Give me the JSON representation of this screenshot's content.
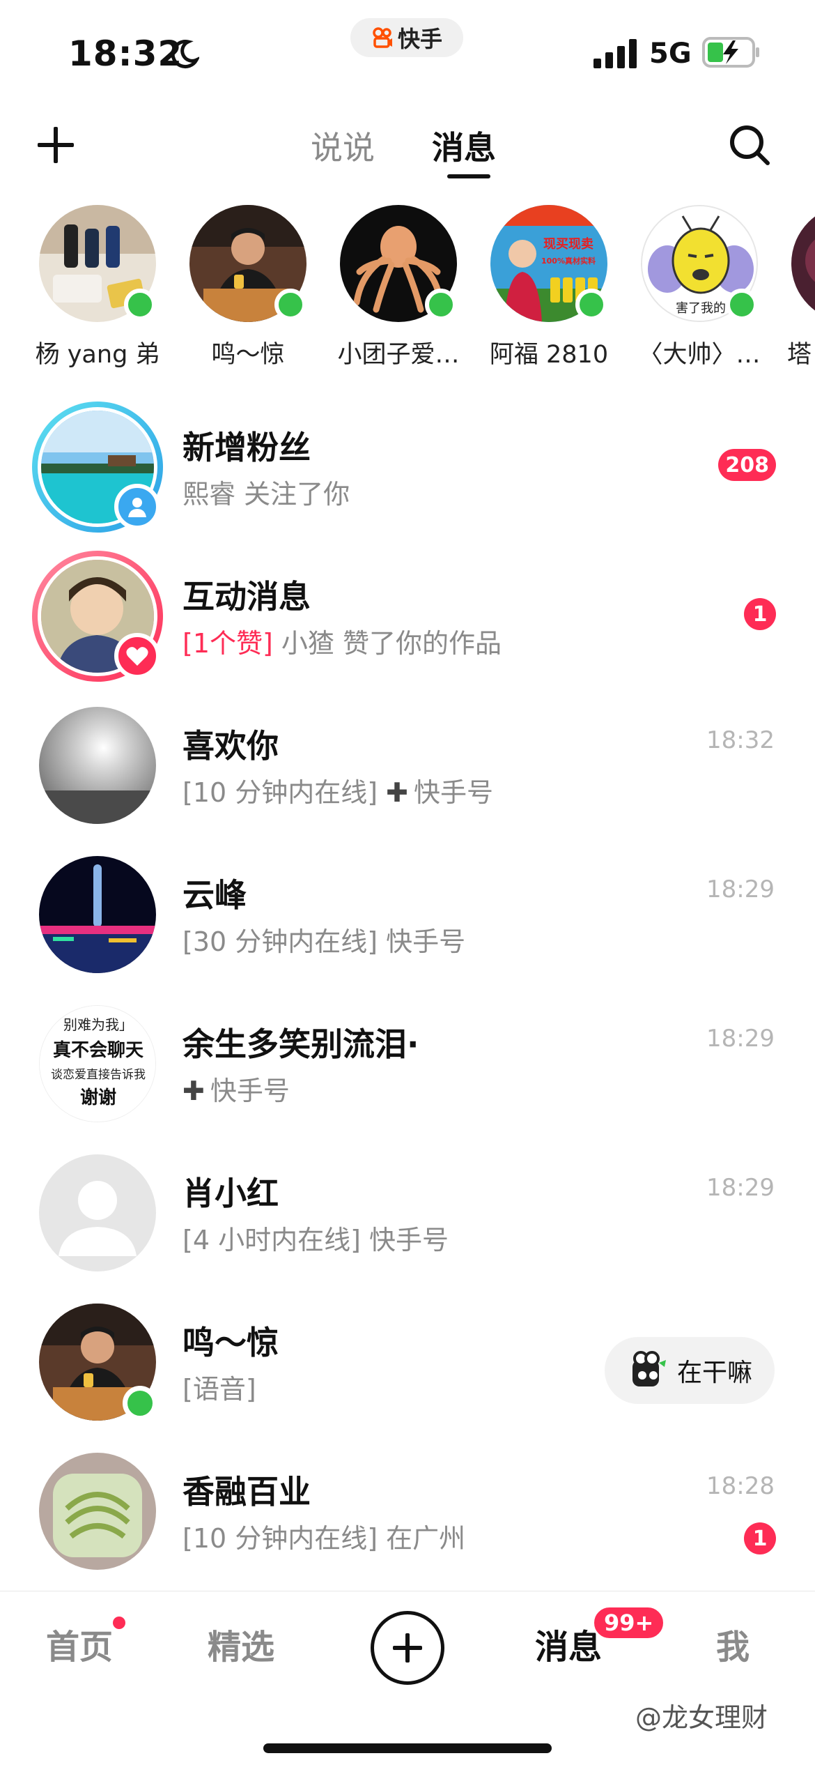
{
  "status_bar": {
    "time": "18:32",
    "network": "5G",
    "app_pill_label": "快手"
  },
  "header": {
    "tabs": [
      {
        "label": "说说",
        "active": false
      },
      {
        "label": "消息",
        "active": true
      }
    ],
    "icons": [
      "plus-icon",
      "search-icon"
    ]
  },
  "stories": [
    {
      "name": "杨 yang 弟",
      "online": true
    },
    {
      "name": "鸣～惊",
      "online": true
    },
    {
      "name": "小团子爱…",
      "online": true
    },
    {
      "name": "阿福 2810",
      "online": true
    },
    {
      "name": "〈大帅〉…",
      "online": true
    },
    {
      "name": "塔",
      "online": false
    }
  ],
  "messages": [
    {
      "name": "新增粉丝",
      "preview": "熙睿 关注了你",
      "time": "",
      "unread": "208"
    },
    {
      "name": "互动消息",
      "preview_highlight": "[1个赞]",
      "preview": " 小猹 赞了你的作品",
      "time": "",
      "unread": "1"
    },
    {
      "name": "喜欢你",
      "preview": "[10 分钟内在线] ",
      "preview_suffix": "快手号",
      "time": "18:32",
      "unread": ""
    },
    {
      "name": "云峰",
      "preview": "[30 分钟内在线] 快手号",
      "time": "18:29",
      "unread": ""
    },
    {
      "name": "余生多笑别流泪·",
      "preview": "快手号",
      "time": "18:29",
      "unread": ""
    },
    {
      "name": "肖小红",
      "preview": "[4 小时内在线] 快手号",
      "time": "18:29",
      "unread": ""
    },
    {
      "name": "鸣～惊",
      "preview": "[语音]",
      "time": "",
      "unread": "",
      "action_label": "在干嘛"
    },
    {
      "name": "香融百业",
      "preview": "[10 分钟内在线] 在广州",
      "time": "18:28",
      "unread": "1"
    }
  ],
  "avatar_text": {
    "story_bee": "害了我的",
    "yusheng_lines": [
      "别难为我」",
      "真不会聊天",
      "谈恋爱直接告诉我",
      "谢谢"
    ],
    "afu_lines": [
      "现买现卖",
      "100%真材实料"
    ]
  },
  "bottom_nav": {
    "items": [
      "首页",
      "精选",
      "消息",
      "我"
    ],
    "message_count": "99+",
    "watermark": "@龙女理财"
  },
  "colors": {
    "accent_red": "#fe2c55",
    "online_green": "#36c24a",
    "muted_text": "#8a8a8a"
  }
}
